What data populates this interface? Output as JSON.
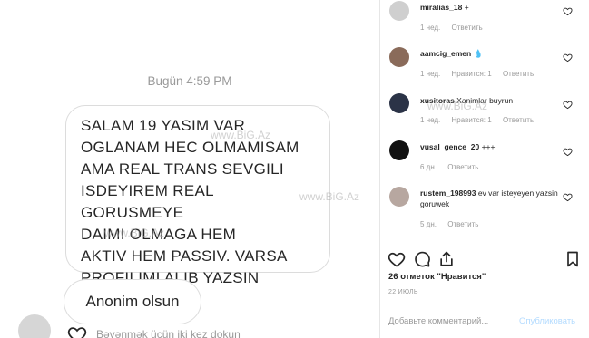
{
  "dm": {
    "timestamp": "Bugün 4:59 PM",
    "message": "SALAM 19 YASIM VAR\nOGLANAM HEC OLMAMISAM\nAMA REAL TRANS SEVGILI\nISDEYIREM REAL GORUSMEYE\nDAIMI OLMAGA HEM\nAKTIV HEM PASSIV. VARSA\nPROFILIMI ALIB YAZSIN",
    "reply": "Anonim olsun",
    "bottom_caption": "Bəyənmək üçün iki kez dokun"
  },
  "watermarks": [
    "www.BiG.Az",
    "www.BiG.Az",
    "www.BiG.Az",
    "www.BiG.Az"
  ],
  "comments": [
    {
      "user": "miralias_18",
      "text": "+",
      "age": "1 нед.",
      "likes": "",
      "reply": "Ответить",
      "avatar_color": "#cfcfcf"
    },
    {
      "user": "aamcig_emen",
      "text": "💧",
      "age": "1 нед.",
      "likes": "Нравится: 1",
      "reply": "Ответить",
      "avatar_color": "#8a6b5a"
    },
    {
      "user": "xusitoras",
      "text": "Xanimlar buyrun",
      "age": "1 нед.",
      "likes": "Нравится: 1",
      "reply": "Ответить",
      "avatar_color": "#2b3347"
    },
    {
      "user": "vusal_gence_20",
      "text": "+++",
      "age": "6 дн.",
      "likes": "",
      "reply": "Ответить",
      "avatar_color": "#111111"
    },
    {
      "user": "rustem_198993",
      "text": "ev var isteyeyen yazsin goruwek",
      "age": "5 дн.",
      "likes": "",
      "reply": "Ответить",
      "avatar_color": "#b7a7a0"
    }
  ],
  "post": {
    "likes": "26 отметок \"Нравится\"",
    "date": "22 ИЮЛЬ",
    "add_comment_placeholder": "Добавьте комментарий...",
    "publish_label": "Опубликовать"
  }
}
